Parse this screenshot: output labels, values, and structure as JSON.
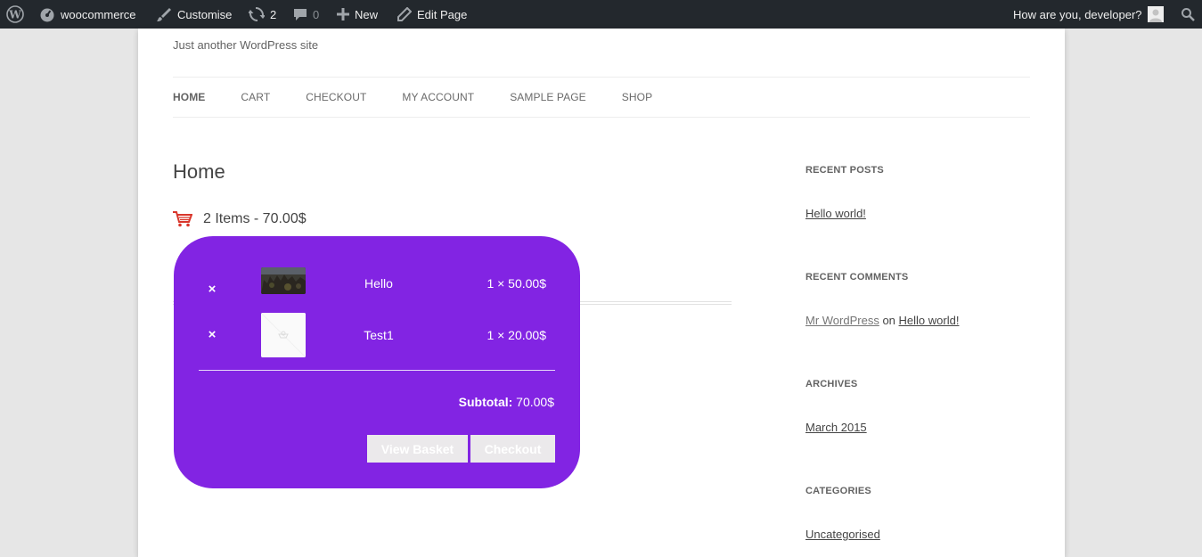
{
  "admin_bar": {
    "site_name": "woocommerce",
    "customise": "Customise",
    "updates_count": "2",
    "comments_count": "0",
    "new": "New",
    "edit_page": "Edit Page",
    "greeting": "How are you, developer?"
  },
  "site": {
    "tagline": "Just another WordPress site"
  },
  "nav": {
    "items": [
      "HOME",
      "CART",
      "CHECKOUT",
      "MY ACCOUNT",
      "SAMPLE PAGE",
      "SHOP"
    ]
  },
  "content": {
    "title": "Home",
    "cart_summary": "2 Items - 70.00$"
  },
  "mini_cart": {
    "remove_symbol": "×",
    "items": [
      {
        "name": "Hello",
        "quantity": "1 × 50.00$"
      },
      {
        "name": "Test1",
        "quantity": "1 × 20.00$"
      }
    ],
    "subtotal_label": "Subtotal:",
    "subtotal_value": "70.00$",
    "view_basket": "View Basket",
    "checkout": "Checkout",
    "bg_color": "#8224e3"
  },
  "sidebar": {
    "recent_posts": {
      "title": "RECENT POSTS",
      "link": "Hello world!"
    },
    "recent_comments": {
      "title": "RECENT COMMENTS",
      "author": "Mr WordPress",
      "on": "on",
      "post": "Hello world!"
    },
    "archives": {
      "title": "ARCHIVES",
      "link": "March 2015"
    },
    "categories": {
      "title": "CATEGORIES",
      "link": "Uncategorised"
    }
  }
}
